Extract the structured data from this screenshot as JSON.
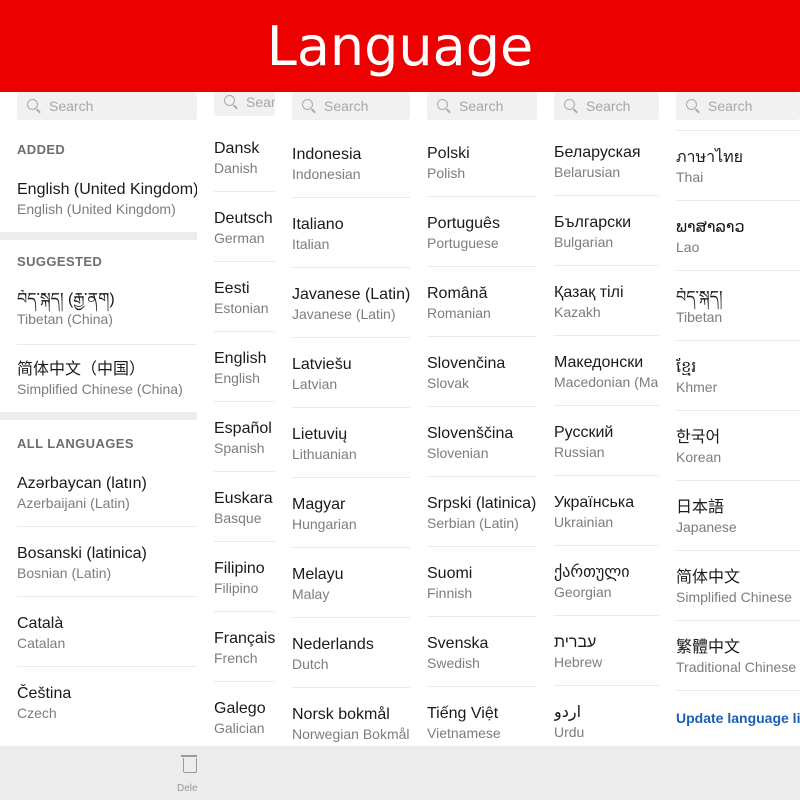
{
  "header": {
    "title": "Language"
  },
  "search": {
    "placeholder": "Search"
  },
  "sections": {
    "added": "ADDED",
    "suggested": "SUGGESTED",
    "all": "ALL LANGUAGES"
  },
  "panel1": {
    "added": [
      {
        "name": "English (United Kingdom)",
        "sub": "English (United Kingdom)"
      }
    ],
    "suggested": [
      {
        "name": "བོད་སྐད། (རྒྱ་ནག)",
        "sub": "Tibetan (China)"
      },
      {
        "name": "简体中文（中国）",
        "sub": "Simplified Chinese (China)"
      }
    ],
    "all": [
      {
        "name": "Azərbaycan (latın)",
        "sub": "Azerbaijani (Latin)"
      },
      {
        "name": "Bosanski (latinica)",
        "sub": "Bosnian (Latin)"
      },
      {
        "name": "Català",
        "sub": "Catalan"
      },
      {
        "name": "Čeština",
        "sub": "Czech"
      }
    ]
  },
  "columns": [
    {
      "search": "Sear",
      "items": [
        {
          "name": "Dansk",
          "sub": "Danish"
        },
        {
          "name": "Deutsch",
          "sub": "German"
        },
        {
          "name": "Eesti",
          "sub": "Estonian"
        },
        {
          "name": "English",
          "sub": "English"
        },
        {
          "name": "Español",
          "sub": "Spanish"
        },
        {
          "name": "Euskara",
          "sub": "Basque"
        },
        {
          "name": "Filipino",
          "sub": "Filipino"
        },
        {
          "name": "Français",
          "sub": "French"
        },
        {
          "name": "Galego",
          "sub": "Galician"
        }
      ]
    },
    {
      "search": "Search",
      "items": [
        {
          "name": "Indonesia",
          "sub": "Indonesian"
        },
        {
          "name": "Italiano",
          "sub": "Italian"
        },
        {
          "name": "Javanese (Latin)",
          "sub": "Javanese (Latin)"
        },
        {
          "name": "Latviešu",
          "sub": "Latvian"
        },
        {
          "name": "Lietuvių",
          "sub": "Lithuanian"
        },
        {
          "name": "Magyar",
          "sub": "Hungarian"
        },
        {
          "name": "Melayu",
          "sub": "Malay"
        },
        {
          "name": "Nederlands",
          "sub": "Dutch"
        },
        {
          "name": "Norsk bokmål",
          "sub": "Norwegian Bokmål"
        }
      ]
    },
    {
      "search": "Search",
      "items": [
        {
          "name": "Polski",
          "sub": "Polish"
        },
        {
          "name": "Português",
          "sub": "Portuguese"
        },
        {
          "name": "Română",
          "sub": "Romanian"
        },
        {
          "name": "Slovenčina",
          "sub": "Slovak"
        },
        {
          "name": "Slovenščina",
          "sub": "Slovenian"
        },
        {
          "name": "Srpski (latinica)",
          "sub": "Serbian (Latin)"
        },
        {
          "name": "Suomi",
          "sub": "Finnish"
        },
        {
          "name": "Svenska",
          "sub": "Swedish"
        },
        {
          "name": "Tiếng Việt",
          "sub": "Vietnamese"
        }
      ]
    },
    {
      "search": "Search",
      "items": [
        {
          "name": "Беларуская",
          "sub": "Belarusian"
        },
        {
          "name": "Български",
          "sub": "Bulgarian"
        },
        {
          "name": "Қазақ тілі",
          "sub": "Kazakh"
        },
        {
          "name": "Македонски",
          "sub": "Macedonian (Ma"
        },
        {
          "name": "Русский",
          "sub": "Russian"
        },
        {
          "name": "Українська",
          "sub": "Ukrainian"
        },
        {
          "name": "ქართული",
          "sub": "Georgian"
        },
        {
          "name": "עברית",
          "sub": "Hebrew"
        },
        {
          "name": "اردو",
          "sub": "Urdu"
        }
      ]
    },
    {
      "search": "Search",
      "items": [
        {
          "name": "ภาษาไทย",
          "sub": "Thai"
        },
        {
          "name": "ພາສາລາວ",
          "sub": "Lao"
        },
        {
          "name": "བོད་སྐད།",
          "sub": "Tibetan"
        },
        {
          "name": "ខ្មែរ",
          "sub": "Khmer"
        },
        {
          "name": "한국어",
          "sub": "Korean"
        },
        {
          "name": "日本語",
          "sub": "Japanese"
        },
        {
          "name": "简体中文",
          "sub": "Simplified Chinese"
        },
        {
          "name": "繁體中文",
          "sub": "Traditional Chinese"
        }
      ],
      "link": "Update language list"
    }
  ],
  "bottom": {
    "delete": "Dele"
  }
}
